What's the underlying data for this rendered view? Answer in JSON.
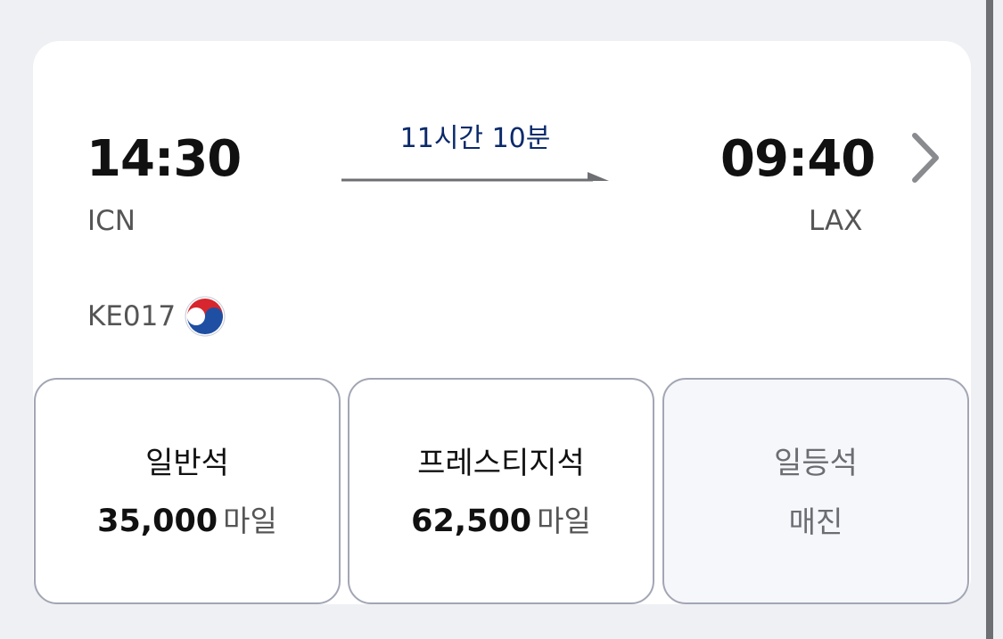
{
  "flight": {
    "departure": {
      "time": "14:30",
      "airport": "ICN"
    },
    "arrival": {
      "time": "09:40",
      "airport": "LAX"
    },
    "duration": "11시간 10분",
    "flight_number": "KE017",
    "airline_logo_icon": "taegeuk-logo-icon"
  },
  "fares": [
    {
      "name": "일반석",
      "price": "35,000",
      "unit": "마일"
    },
    {
      "name": "프레스티지석",
      "price": "62,500",
      "unit": "마일"
    },
    {
      "name": "일등석",
      "status": "매진"
    }
  ],
  "colors": {
    "accent_navy": "#0b2a6b",
    "card_border": "#a2a6b4",
    "background": "#eff0f4",
    "logo_red": "#d7262e",
    "logo_blue": "#1f4fa3"
  }
}
